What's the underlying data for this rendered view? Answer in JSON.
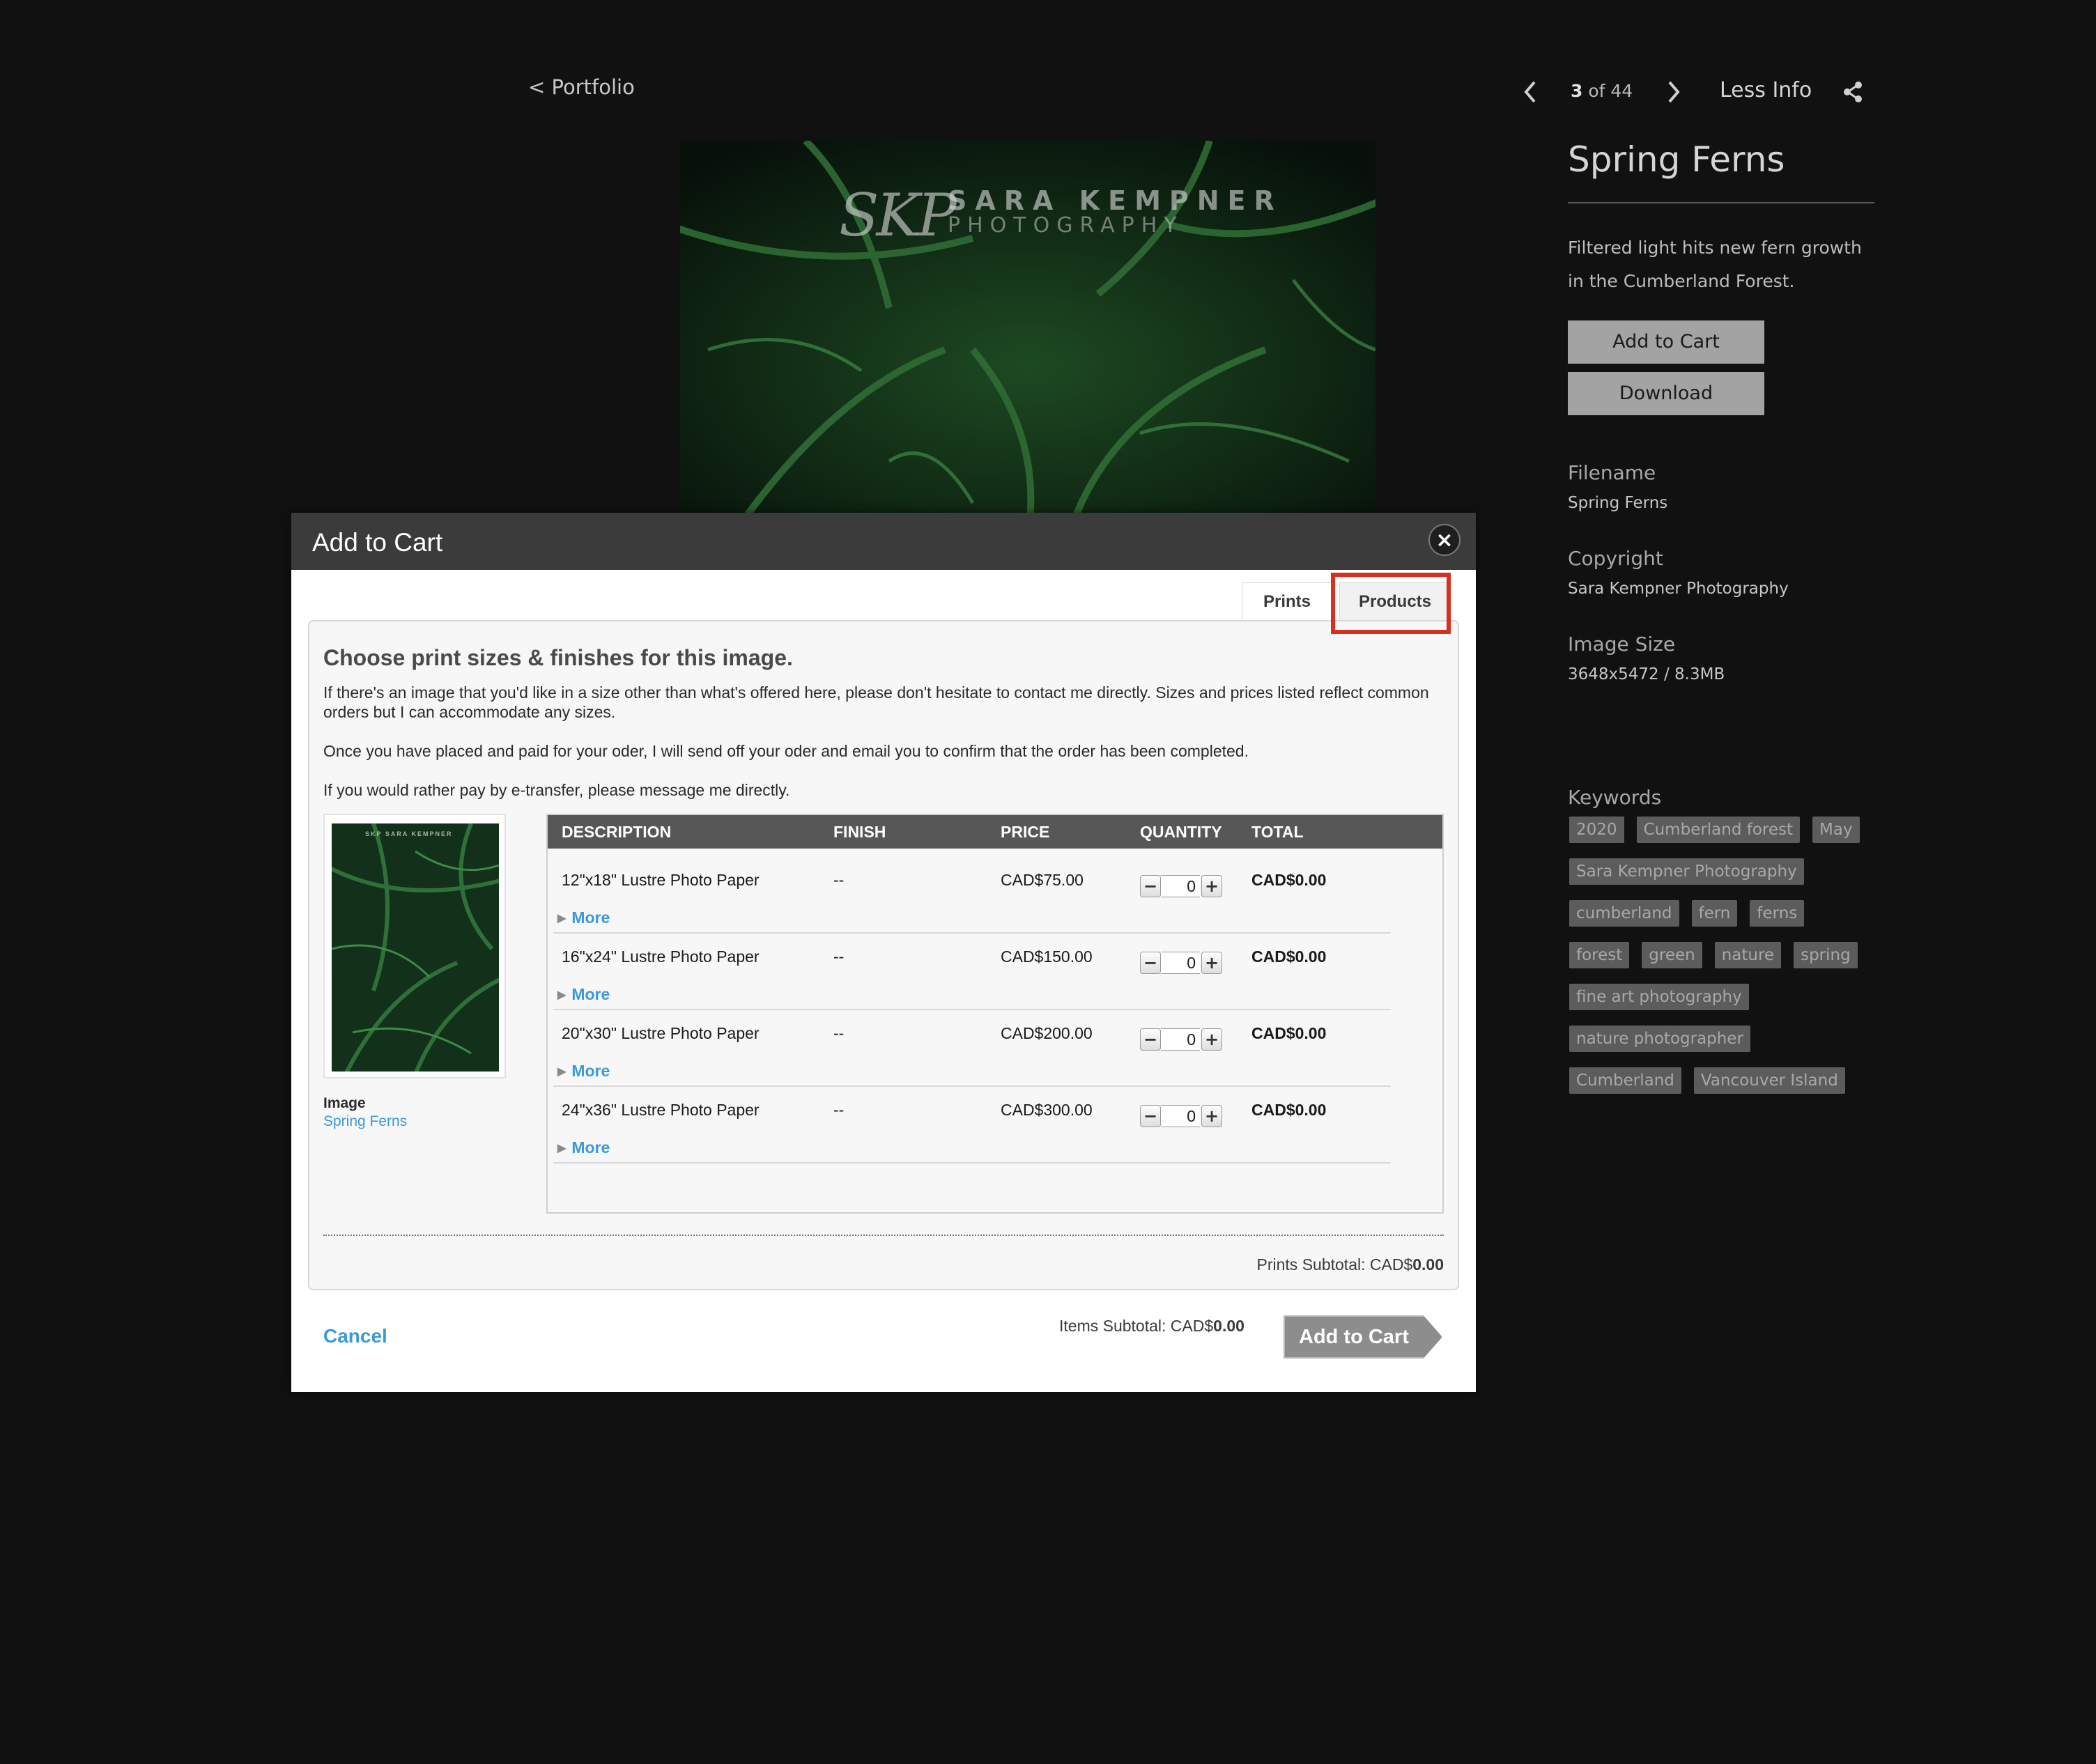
{
  "topbar": {
    "back_label": "< Portfolio",
    "counter_current": "3",
    "counter_rest": " of 44",
    "less_info_label": "Less Info"
  },
  "photo": {
    "watermark_mark": "SKP",
    "watermark_name": "SARA KEMPNER",
    "watermark_sub": "PHOTOGRAPHY"
  },
  "info": {
    "title": "Spring Ferns",
    "description": "Filtered light hits new fern growth in the Cumberland Forest.",
    "add_to_cart_label": "Add to Cart",
    "download_label": "Download",
    "filename_label": "Filename",
    "filename_value": "Spring Ferns",
    "copyright_label": "Copyright",
    "copyright_value": "Sara Kempner Photography",
    "image_size_label": "Image Size",
    "image_size_value": "3648x5472 / 8.3MB",
    "keywords_label": "Keywords",
    "keywords": [
      [
        "2020",
        "Cumberland forest",
        "May"
      ],
      [
        "Sara Kempner Photography"
      ],
      [
        "cumberland",
        "fern",
        "ferns"
      ],
      [
        "forest",
        "green",
        "nature",
        "spring"
      ],
      [
        "fine art photography"
      ],
      [
        "nature photographer"
      ],
      [
        "Cumberland",
        "Vancouver Island"
      ]
    ]
  },
  "modal": {
    "title": "Add to Cart",
    "close_label": "×",
    "tabs": {
      "prints": "Prints",
      "products": "Products"
    },
    "heading": "Choose print sizes & finishes for this image.",
    "para1": "If there's an image that you'd like in a size other than what's offered here, please don't hesitate to contact me directly. Sizes and prices listed reflect common orders but I can accommodate any sizes.",
    "para2": "Once you have placed and paid for your oder, I will send off your oder and email you to confirm that the order has been completed.",
    "para3": "If you would rather pay by e-transfer, please message me directly.",
    "image_label": "Image",
    "image_link": "Spring Ferns",
    "thumb_watermark": "SKP SARA KEMPNER",
    "columns": {
      "description": "DESCRIPTION",
      "finish": "FINISH",
      "price": "PRICE",
      "quantity": "QUANTITY",
      "total": "TOTAL"
    },
    "rows": [
      {
        "description": "12\"x18\" Lustre Photo Paper",
        "finish": "--",
        "price": "CAD$75.00",
        "quantity": "0",
        "total": "CAD$0.00",
        "more": "More"
      },
      {
        "description": "16\"x24\" Lustre Photo Paper",
        "finish": "--",
        "price": "CAD$150.00",
        "quantity": "0",
        "total": "CAD$0.00",
        "more": "More"
      },
      {
        "description": "20\"x30\" Lustre Photo Paper",
        "finish": "--",
        "price": "CAD$200.00",
        "quantity": "0",
        "total": "CAD$0.00",
        "more": "More"
      },
      {
        "description": "24\"x36\" Lustre Photo Paper",
        "finish": "--",
        "price": "CAD$300.00",
        "quantity": "0",
        "total": "CAD$0.00",
        "more": "More"
      }
    ],
    "prints_subtotal_label": "Prints Subtotal: CAD$",
    "prints_subtotal_value": "0.00",
    "cancel_label": "Cancel",
    "items_subtotal_label": "Items Subtotal: CAD$",
    "items_subtotal_value": "0.00",
    "add_to_cart_label": "Add to Cart"
  },
  "colors": {
    "background": "#111111",
    "link_blue": "#3a9ad9",
    "highlight_red": "#d7301f",
    "table_header": "#575757"
  }
}
